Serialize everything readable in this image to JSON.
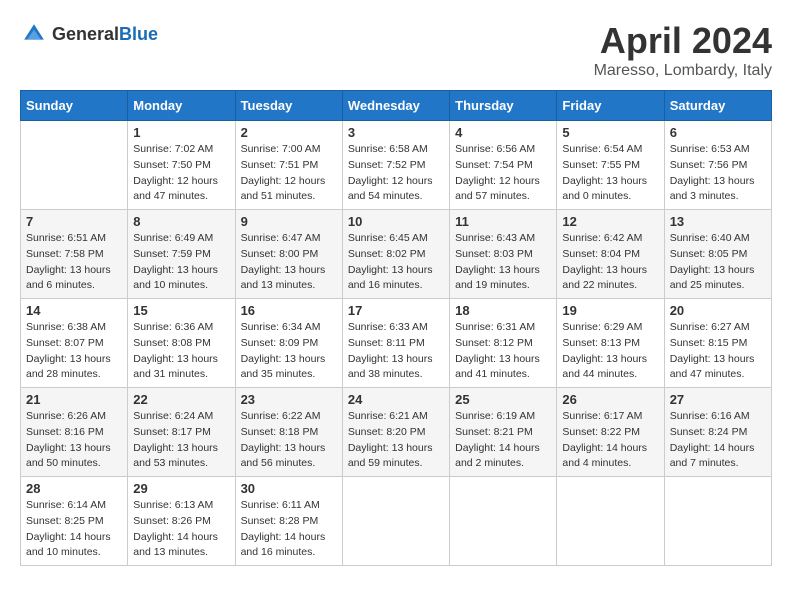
{
  "header": {
    "logo_general": "General",
    "logo_blue": "Blue",
    "title": "April 2024",
    "subtitle": "Maresso, Lombardy, Italy"
  },
  "calendar": {
    "days_of_week": [
      "Sunday",
      "Monday",
      "Tuesday",
      "Wednesday",
      "Thursday",
      "Friday",
      "Saturday"
    ],
    "weeks": [
      [
        {
          "day": "",
          "info": ""
        },
        {
          "day": "1",
          "info": "Sunrise: 7:02 AM\nSunset: 7:50 PM\nDaylight: 12 hours\nand 47 minutes."
        },
        {
          "day": "2",
          "info": "Sunrise: 7:00 AM\nSunset: 7:51 PM\nDaylight: 12 hours\nand 51 minutes."
        },
        {
          "day": "3",
          "info": "Sunrise: 6:58 AM\nSunset: 7:52 PM\nDaylight: 12 hours\nand 54 minutes."
        },
        {
          "day": "4",
          "info": "Sunrise: 6:56 AM\nSunset: 7:54 PM\nDaylight: 12 hours\nand 57 minutes."
        },
        {
          "day": "5",
          "info": "Sunrise: 6:54 AM\nSunset: 7:55 PM\nDaylight: 13 hours\nand 0 minutes."
        },
        {
          "day": "6",
          "info": "Sunrise: 6:53 AM\nSunset: 7:56 PM\nDaylight: 13 hours\nand 3 minutes."
        }
      ],
      [
        {
          "day": "7",
          "info": "Sunrise: 6:51 AM\nSunset: 7:58 PM\nDaylight: 13 hours\nand 6 minutes."
        },
        {
          "day": "8",
          "info": "Sunrise: 6:49 AM\nSunset: 7:59 PM\nDaylight: 13 hours\nand 10 minutes."
        },
        {
          "day": "9",
          "info": "Sunrise: 6:47 AM\nSunset: 8:00 PM\nDaylight: 13 hours\nand 13 minutes."
        },
        {
          "day": "10",
          "info": "Sunrise: 6:45 AM\nSunset: 8:02 PM\nDaylight: 13 hours\nand 16 minutes."
        },
        {
          "day": "11",
          "info": "Sunrise: 6:43 AM\nSunset: 8:03 PM\nDaylight: 13 hours\nand 19 minutes."
        },
        {
          "day": "12",
          "info": "Sunrise: 6:42 AM\nSunset: 8:04 PM\nDaylight: 13 hours\nand 22 minutes."
        },
        {
          "day": "13",
          "info": "Sunrise: 6:40 AM\nSunset: 8:05 PM\nDaylight: 13 hours\nand 25 minutes."
        }
      ],
      [
        {
          "day": "14",
          "info": "Sunrise: 6:38 AM\nSunset: 8:07 PM\nDaylight: 13 hours\nand 28 minutes."
        },
        {
          "day": "15",
          "info": "Sunrise: 6:36 AM\nSunset: 8:08 PM\nDaylight: 13 hours\nand 31 minutes."
        },
        {
          "day": "16",
          "info": "Sunrise: 6:34 AM\nSunset: 8:09 PM\nDaylight: 13 hours\nand 35 minutes."
        },
        {
          "day": "17",
          "info": "Sunrise: 6:33 AM\nSunset: 8:11 PM\nDaylight: 13 hours\nand 38 minutes."
        },
        {
          "day": "18",
          "info": "Sunrise: 6:31 AM\nSunset: 8:12 PM\nDaylight: 13 hours\nand 41 minutes."
        },
        {
          "day": "19",
          "info": "Sunrise: 6:29 AM\nSunset: 8:13 PM\nDaylight: 13 hours\nand 44 minutes."
        },
        {
          "day": "20",
          "info": "Sunrise: 6:27 AM\nSunset: 8:15 PM\nDaylight: 13 hours\nand 47 minutes."
        }
      ],
      [
        {
          "day": "21",
          "info": "Sunrise: 6:26 AM\nSunset: 8:16 PM\nDaylight: 13 hours\nand 50 minutes."
        },
        {
          "day": "22",
          "info": "Sunrise: 6:24 AM\nSunset: 8:17 PM\nDaylight: 13 hours\nand 53 minutes."
        },
        {
          "day": "23",
          "info": "Sunrise: 6:22 AM\nSunset: 8:18 PM\nDaylight: 13 hours\nand 56 minutes."
        },
        {
          "day": "24",
          "info": "Sunrise: 6:21 AM\nSunset: 8:20 PM\nDaylight: 13 hours\nand 59 minutes."
        },
        {
          "day": "25",
          "info": "Sunrise: 6:19 AM\nSunset: 8:21 PM\nDaylight: 14 hours\nand 2 minutes."
        },
        {
          "day": "26",
          "info": "Sunrise: 6:17 AM\nSunset: 8:22 PM\nDaylight: 14 hours\nand 4 minutes."
        },
        {
          "day": "27",
          "info": "Sunrise: 6:16 AM\nSunset: 8:24 PM\nDaylight: 14 hours\nand 7 minutes."
        }
      ],
      [
        {
          "day": "28",
          "info": "Sunrise: 6:14 AM\nSunset: 8:25 PM\nDaylight: 14 hours\nand 10 minutes."
        },
        {
          "day": "29",
          "info": "Sunrise: 6:13 AM\nSunset: 8:26 PM\nDaylight: 14 hours\nand 13 minutes."
        },
        {
          "day": "30",
          "info": "Sunrise: 6:11 AM\nSunset: 8:28 PM\nDaylight: 14 hours\nand 16 minutes."
        },
        {
          "day": "",
          "info": ""
        },
        {
          "day": "",
          "info": ""
        },
        {
          "day": "",
          "info": ""
        },
        {
          "day": "",
          "info": ""
        }
      ]
    ]
  }
}
